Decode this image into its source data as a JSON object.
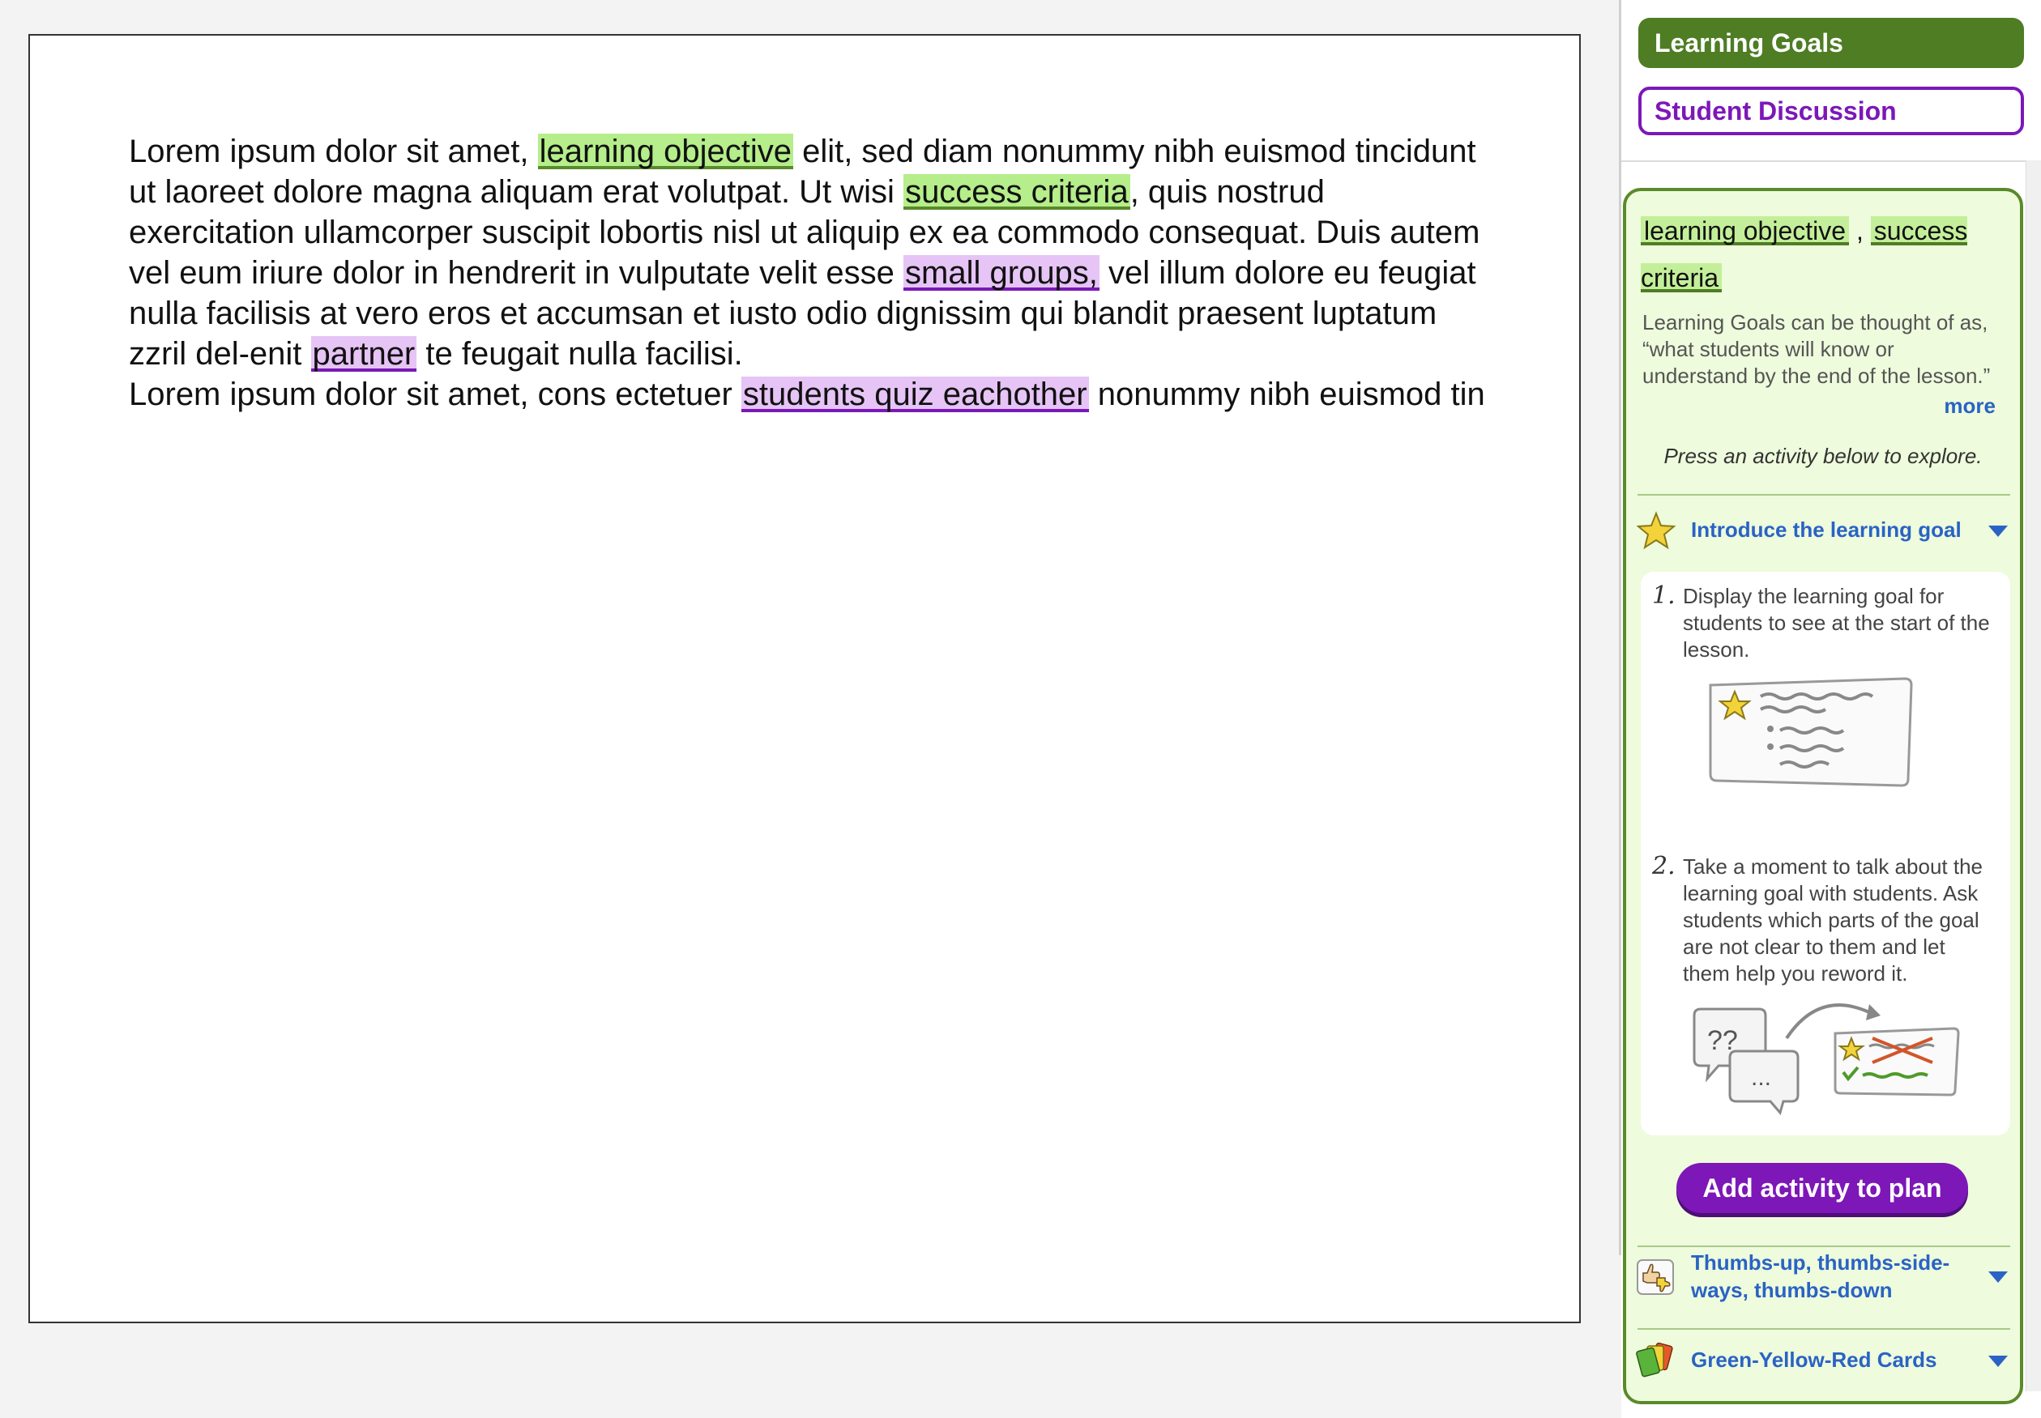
{
  "document": {
    "paragraph": [
      {
        "t": "Lorem ipsum dolor sit amet, ",
        "h": ""
      },
      {
        "t": "learning objective",
        "h": "g"
      },
      {
        "t": " elit, sed diam nonummy nibh euismod tincidunt ut laoreet dolore magna aliquam erat volutpat. Ut wisi ",
        "h": ""
      },
      {
        "t": "success criteria",
        "h": "g"
      },
      {
        "t": ", quis nostrud exercitation ullamcorper suscipit lobortis nisl ut aliquip ex ea commodo consequat. Duis autem vel eum iriure dolor in hendrerit in vulputate velit esse ",
        "h": ""
      },
      {
        "t": "small groups,",
        "h": "p"
      },
      {
        "t": " vel illum dolore eu feugiat nulla facilisis at vero eros et accumsan et iusto odio dignissim qui blandit praesent luptatum zzril del-enit ",
        "h": ""
      },
      {
        "t": "partner",
        "h": "p"
      },
      {
        "t": " te feugait nulla facilisi.",
        "h": ""
      },
      {
        "t": "\n",
        "h": "br"
      },
      {
        "t": "Lorem ipsum dolor sit amet, cons ectetuer ",
        "h": ""
      },
      {
        "t": "students quiz eachother",
        "h": "p"
      },
      {
        "t": " nonummy nibh euismod tin",
        "h": ""
      }
    ]
  },
  "sidebar": {
    "tab_goals": "Learning Goals",
    "tab_discussion": "Student Discussion",
    "card": {
      "tag_1": "learning objective",
      "tag_sep": ",",
      "tag_2": "success criteria",
      "description": "Learning Goals can be thought of as, “what students will know or understand by the end of the lesson.”",
      "more": "more",
      "instruction": "Press an activity below to explore.",
      "activities": [
        {
          "title": "Introduce the learning goal",
          "icon": "star-icon",
          "expanded": true
        },
        {
          "title": "Thumbs-up, thumbs-side-ways, thumbs-down",
          "icon": "thumbs-icon",
          "expanded": false
        },
        {
          "title": "Green-Yellow-Red Cards",
          "icon": "cards-icon",
          "expanded": false
        }
      ],
      "steps": [
        {
          "num": "1.",
          "text": "Display the learning goal for students to see at the start of the lesson."
        },
        {
          "num": "2.",
          "text": "Take a moment to talk about the learning goal with students. Ask students which parts of the goal are not clear to them and let them help you reword it."
        }
      ],
      "illustration_2_bubble_1": "??",
      "illustration_2_bubble_2": "...",
      "add_button": "Add activity to plan"
    }
  },
  "colors": {
    "green_dark": "#4e7d24",
    "purple": "#7d17b8",
    "link_blue": "#2a63c5",
    "highlight_green": "#b5ee8a",
    "highlight_purple": "#e6c4f6"
  }
}
